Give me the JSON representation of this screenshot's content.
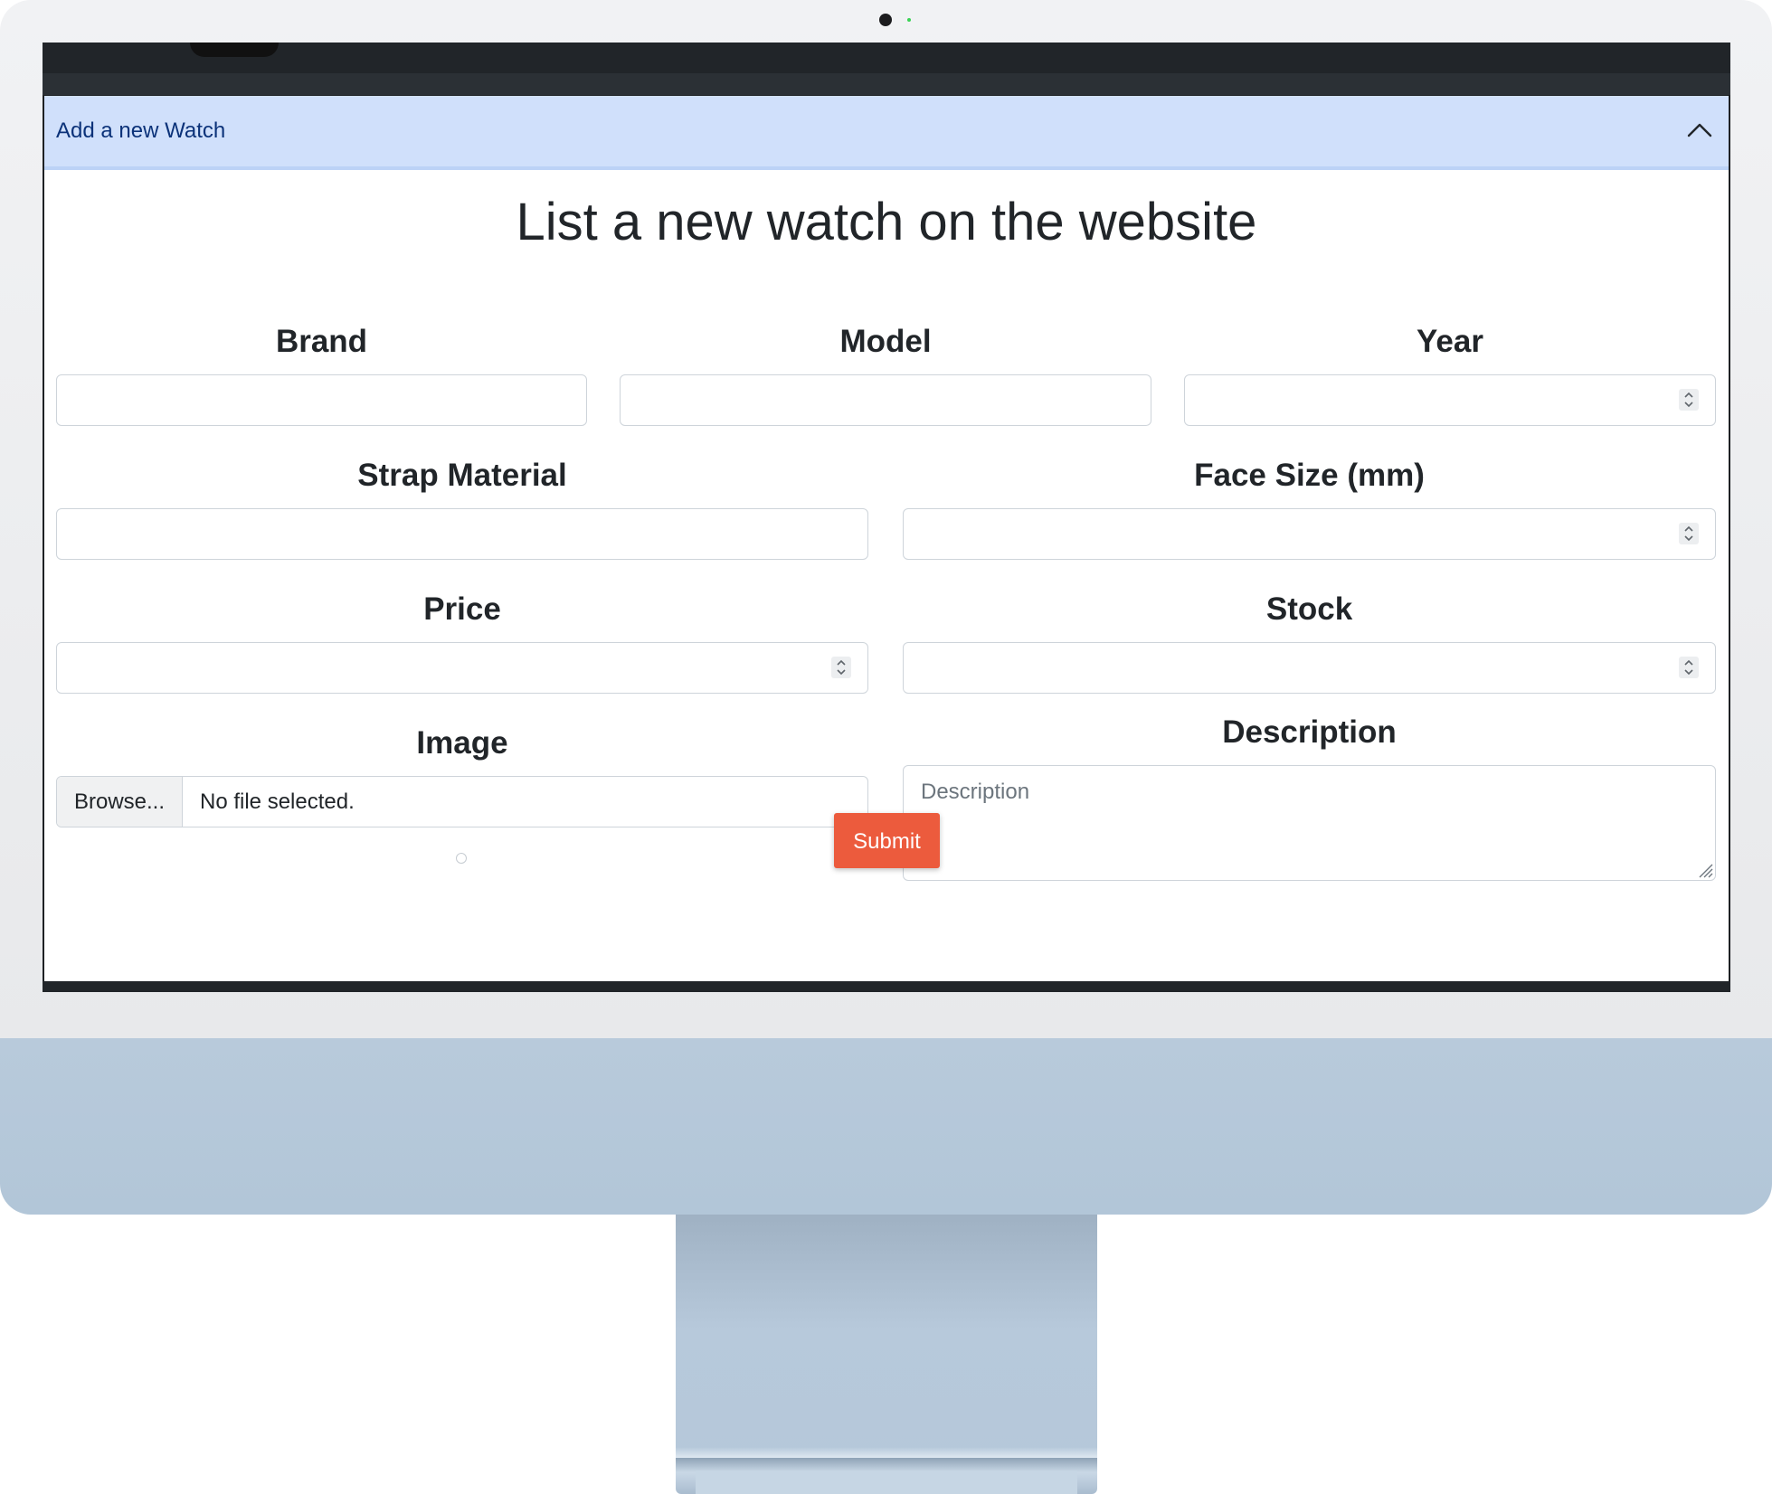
{
  "accordion": {
    "header_label": "Add a new Watch",
    "toggle_icon": "chevron-up-icon",
    "expanded": true
  },
  "form": {
    "title": "List a new watch on the website",
    "fields": {
      "brand": {
        "label": "Brand",
        "value": ""
      },
      "model": {
        "label": "Model",
        "value": ""
      },
      "year": {
        "label": "Year",
        "value": "",
        "type": "number"
      },
      "strap_material": {
        "label": "Strap Material",
        "value": ""
      },
      "face_size": {
        "label": "Face Size (mm)",
        "value": "",
        "type": "number"
      },
      "price": {
        "label": "Price",
        "value": "",
        "type": "number"
      },
      "stock": {
        "label": "Stock",
        "value": "",
        "type": "number"
      },
      "image": {
        "label": "Image",
        "browse_label": "Browse...",
        "status": "No file selected."
      },
      "description": {
        "label": "Description",
        "placeholder": "Description",
        "value": ""
      }
    },
    "submit_label": "Submit"
  },
  "colors": {
    "accordion_bg": "#d0e0fb",
    "accordion_text": "#0b3279",
    "submit_bg": "#ec5b3d",
    "monitor_chin": "#b8cadb"
  }
}
